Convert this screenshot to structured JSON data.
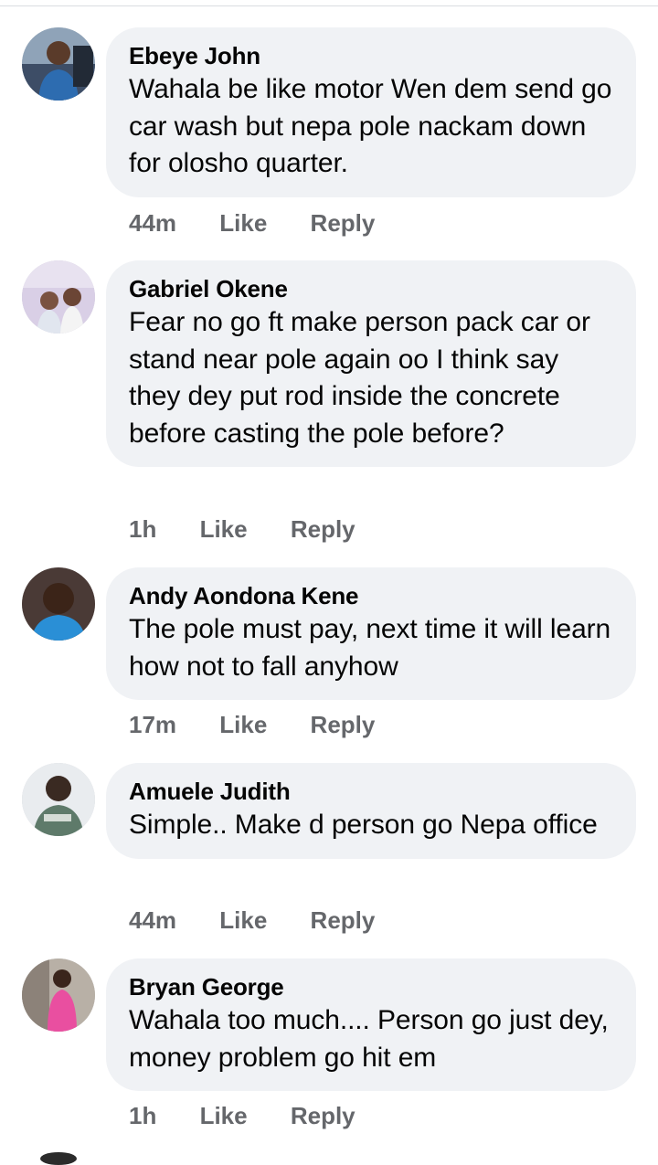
{
  "comments": [
    {
      "author": "Ebeye John",
      "text": "Wahala be like motor Wen dem send go car wash but nepa pole nackam down for olosho quarter.",
      "time": "44m",
      "like_label": "Like",
      "reply_label": "Reply",
      "avatar_icon": "profile-photo-icon"
    },
    {
      "author": "Gabriel Okene",
      "text": "Fear no go ft make person pack car or stand near pole again oo I think say they dey put rod inside the concrete before casting the pole before?",
      "time": "1h",
      "like_label": "Like",
      "reply_label": "Reply",
      "avatar_icon": "profile-photo-icon"
    },
    {
      "author": "Andy Aondona Kene",
      "text": "The pole must pay, next time it will learn how not to fall anyhow",
      "time": "17m",
      "like_label": "Like",
      "reply_label": "Reply",
      "avatar_icon": "profile-photo-icon"
    },
    {
      "author": "Amuele Judith",
      "text": "Simple.. Make d person go Nepa office",
      "time": "44m",
      "like_label": "Like",
      "reply_label": "Reply",
      "avatar_icon": "profile-photo-icon"
    },
    {
      "author": "Bryan George",
      "text": "Wahala too much.... Person go just dey, money problem go hit em",
      "time": "1h",
      "like_label": "Like",
      "reply_label": "Reply",
      "avatar_icon": "profile-photo-icon"
    }
  ],
  "colors": {
    "bubble_bg": "#f0f2f5",
    "meta_text": "#65676b",
    "primary_text": "#050505"
  }
}
